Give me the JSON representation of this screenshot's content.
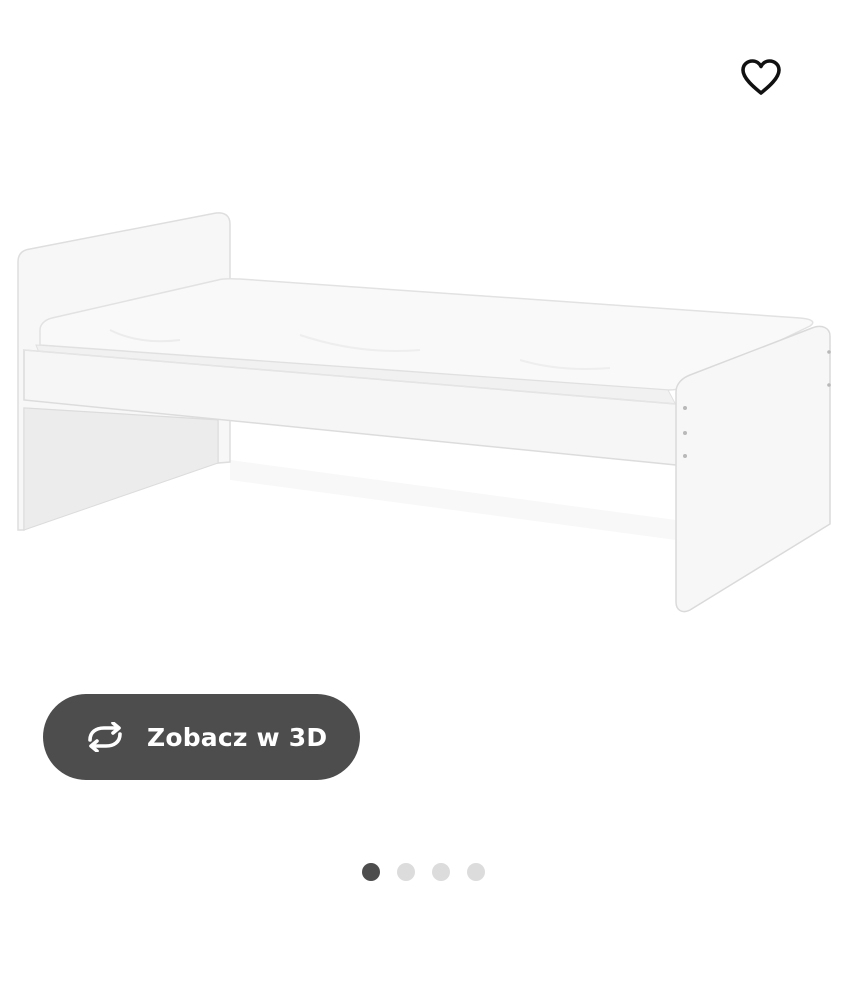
{
  "gallery": {
    "favourite_icon": "heart-outline-icon",
    "product_image_alt": "",
    "view_3d": {
      "icon": "rotate-3d-icon",
      "label": "Zobacz w 3D"
    },
    "carousel": {
      "total_slides": 4,
      "active_slide": 1
    }
  },
  "colors": {
    "button_background": "#4d4d4d",
    "button_text": "#ffffff",
    "dot_active": "#4d4d4d",
    "dot_inactive": "#dcdcdc",
    "icon_stroke": "#111111"
  }
}
